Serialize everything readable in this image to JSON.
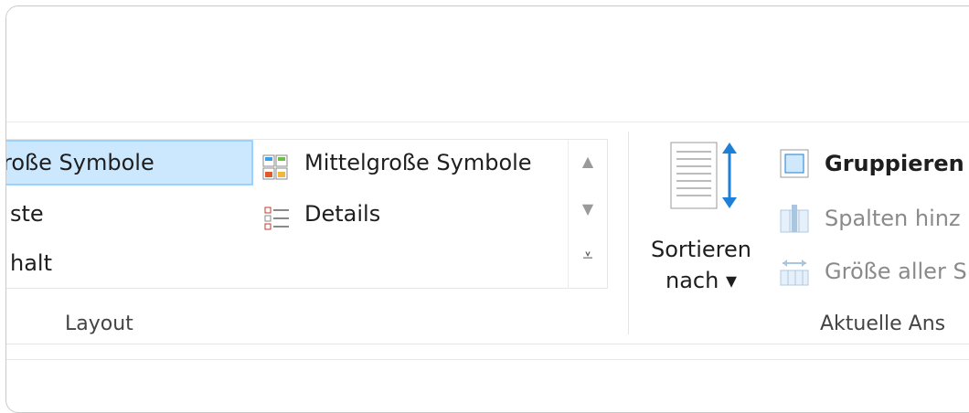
{
  "ribbon": {
    "layout_group": {
      "label": "Layout",
      "items": [
        {
          "label": "roße Symbole",
          "selected": true
        },
        {
          "label": "Mittelgroße Symbole",
          "icon": "medium-icons-icon"
        },
        {
          "label": "ste"
        },
        {
          "label": "Details",
          "icon": "details-view-icon"
        },
        {
          "label": "halt"
        }
      ]
    },
    "current_view_group": {
      "label": "Aktuelle Ans",
      "sort_button": {
        "line1": "Sortieren",
        "line2": "nach ▾"
      },
      "group_by": {
        "label": "Gruppieren"
      },
      "add_columns": {
        "label": "Spalten hinz"
      },
      "size_columns": {
        "label": "Größe aller S"
      }
    }
  },
  "colors": {
    "selection_bg": "#cce8ff",
    "selection_border": "#99d1ff",
    "accent_blue": "#1e7fd6",
    "disabled_text": "#8a8a8a"
  }
}
